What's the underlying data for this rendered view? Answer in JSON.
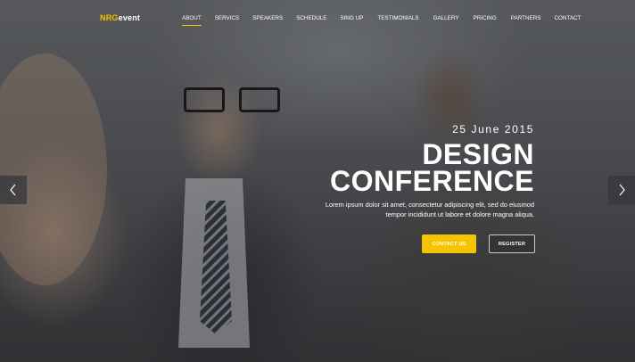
{
  "brand": {
    "logo_prefix": "NRG",
    "logo_suffix": "event"
  },
  "nav": {
    "items": [
      {
        "label": "ABOUT",
        "active": true
      },
      {
        "label": "SERVICS"
      },
      {
        "label": "SPEAKERS"
      },
      {
        "label": "SCHEDULE"
      },
      {
        "label": "SING UP"
      },
      {
        "label": "TESTIMONIALS"
      },
      {
        "label": "GALLERY"
      },
      {
        "label": "PRICING"
      },
      {
        "label": "PARTNERS"
      },
      {
        "label": "CONTACT"
      }
    ]
  },
  "hero": {
    "date": "25 June 2015",
    "title_line1": "DESIGN",
    "title_line2": "CONFERENCE",
    "lead_line1": "Lorem ipsum dolor sit amet, consectetur adipiscing elit, sed do eiusmod",
    "lead_line2": "tempor incididunt ut labore et dolore magna aliqua.",
    "contact_label": "CONTACT US",
    "register_label": "REGISTER"
  },
  "slider": {
    "prev_icon": "chevron-left-icon",
    "next_icon": "chevron-right-icon"
  },
  "colors": {
    "accent": "#f5c400",
    "text": "#ffffff"
  }
}
